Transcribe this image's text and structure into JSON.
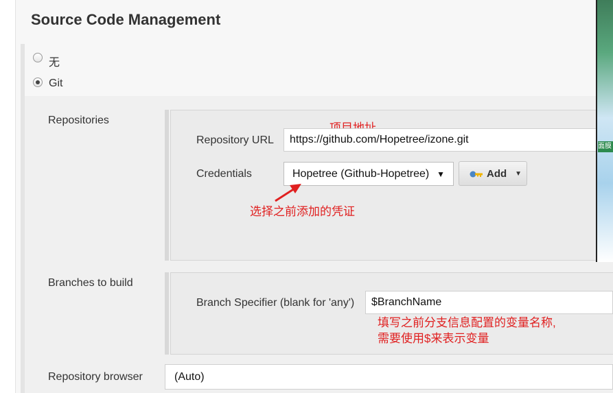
{
  "section": {
    "title": "Source Code Management"
  },
  "scm_options": [
    {
      "label": "无",
      "selected": false
    },
    {
      "label": "Git",
      "selected": true
    }
  ],
  "repositories": {
    "label": "Repositories",
    "url_label": "Repository URL",
    "url_value": "https://github.com/Hopetree/izone.git",
    "credentials_label": "Credentials",
    "credentials_value": "Hopetree (Github-Hopetree)",
    "add_label": "Add"
  },
  "branches": {
    "label": "Branches to build",
    "specifier_label": "Branch Specifier (blank for 'any')",
    "specifier_value": "$BranchName"
  },
  "browser": {
    "label": "Repository browser",
    "value": "(Auto)"
  },
  "annotations": {
    "repo_address": "项目地址",
    "choose_credentials": "选择之前添加的凭证",
    "branch_note_line1": "填写之前分支信息配置的变量名称,",
    "branch_note_line2": "需要使用$来表示变量"
  },
  "side_image": {
    "text": "面膜"
  },
  "colors": {
    "annotation": "#e02020",
    "panel": "#f7f7f7"
  }
}
